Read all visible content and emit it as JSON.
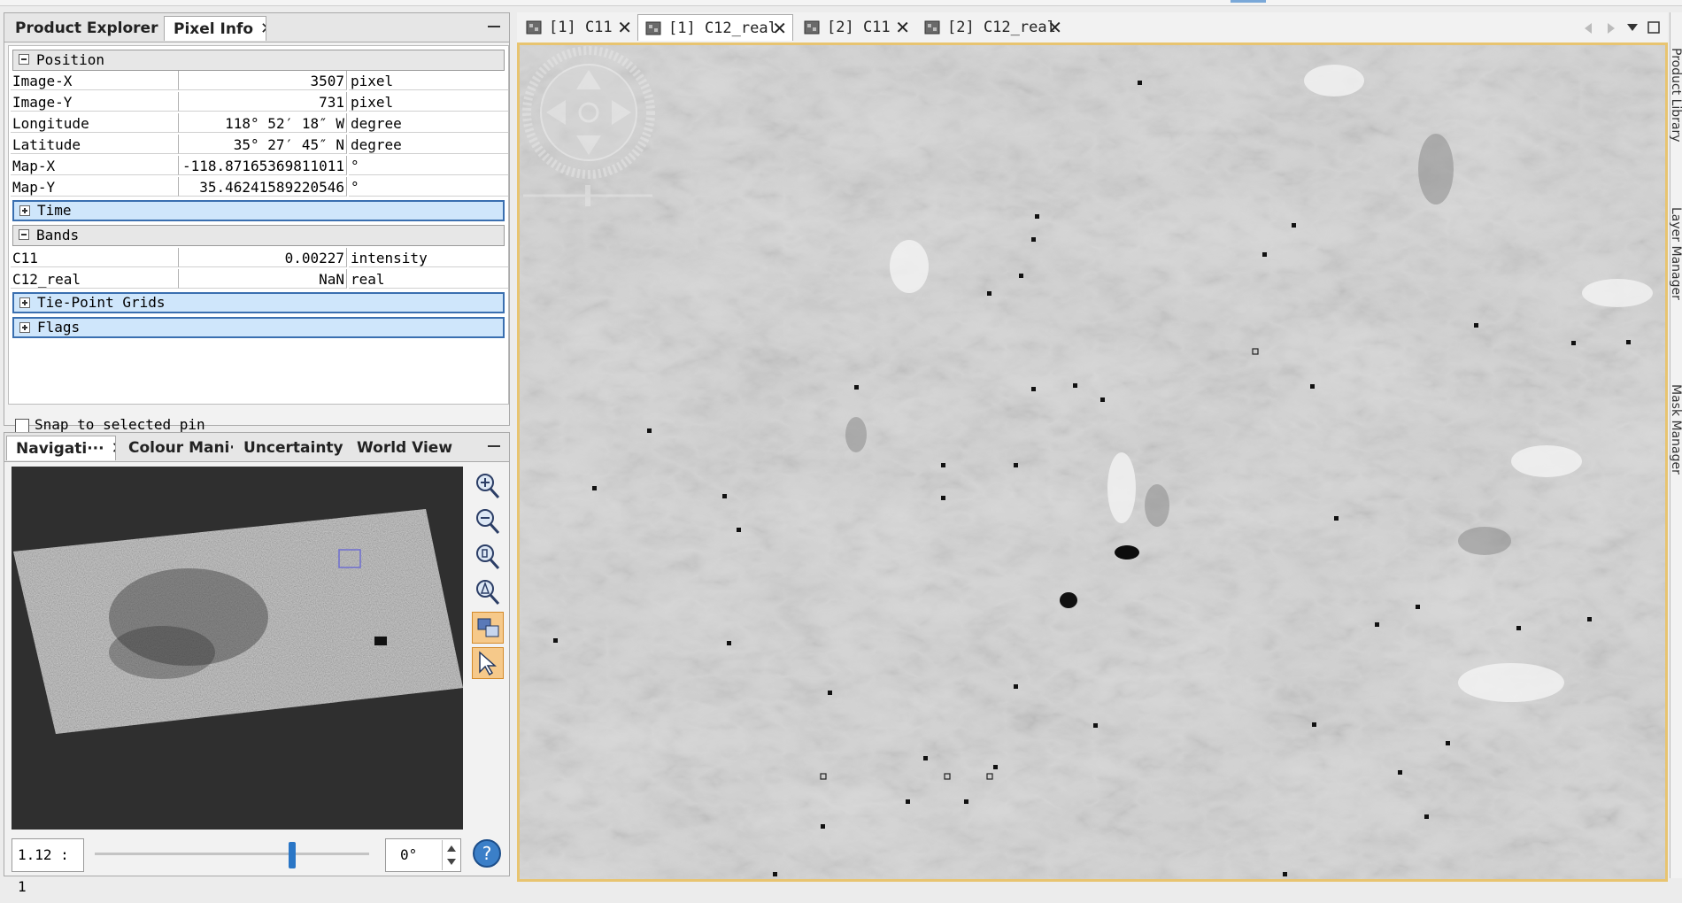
{
  "left_top": {
    "tabs": [
      {
        "label": "Product Explorer"
      },
      {
        "label": "Pixel Info",
        "close": "✕"
      }
    ]
  },
  "pixel_info": {
    "groups": {
      "position": "Position",
      "time": "Time",
      "bands": "Bands",
      "tie_point_grids": "Tie-Point Grids",
      "flags": "Flags"
    },
    "position_rows": [
      {
        "name": "Image-X",
        "value": "3507",
        "unit": "pixel"
      },
      {
        "name": "Image-Y",
        "value": "731",
        "unit": "pixel"
      },
      {
        "name": "Longitude",
        "value": "118° 52′ 18″ W",
        "unit": "degree"
      },
      {
        "name": "Latitude",
        "value": "35° 27′ 45″ N",
        "unit": "degree"
      },
      {
        "name": "Map-X",
        "value": "-118.87165369811011",
        "unit": "°"
      },
      {
        "name": "Map-Y",
        "value": "35.46241589220546",
        "unit": "°"
      }
    ],
    "band_rows": [
      {
        "name": "C11",
        "value": "0.00227",
        "unit": "intensity"
      },
      {
        "name": "C12_real",
        "value": "NaN",
        "unit": "real"
      }
    ],
    "snap_label": "Snap to selected pin"
  },
  "left_bottom": {
    "tabs": [
      {
        "label": "Navigati···",
        "close": "✕"
      },
      {
        "label": "Colour Mani···"
      },
      {
        "label": "Uncertainty ···"
      },
      {
        "label": "World View"
      }
    ],
    "scale_value": "1.12 : 1",
    "rotation_value": "0°",
    "zoom_slider_fraction": 0.72
  },
  "documents": {
    "tabs": [
      {
        "label": "[1] C11",
        "close": "✕"
      },
      {
        "label": "[1] C12_real",
        "close": "✕",
        "active": true
      },
      {
        "label": "[2] C11",
        "close": "✕"
      },
      {
        "label": "[2] C12_real",
        "close": "✕"
      }
    ]
  },
  "side_strip": {
    "labels": [
      "Product Library",
      "Layer Manager",
      "Mask Manager"
    ]
  },
  "colors": {
    "accent_border": "#e8c470",
    "selected_group": "#cfe6fb",
    "slider_thumb": "#2a76c6",
    "active_tool": "#f6c98a"
  },
  "icons": [
    "zoom-in-icon",
    "zoom-out-icon",
    "zoom-pixel-icon",
    "zoom-all-icon",
    "sync-views-icon",
    "sync-cursor-icon",
    "help-icon",
    "band-image-icon",
    "pan-compass-icon"
  ]
}
